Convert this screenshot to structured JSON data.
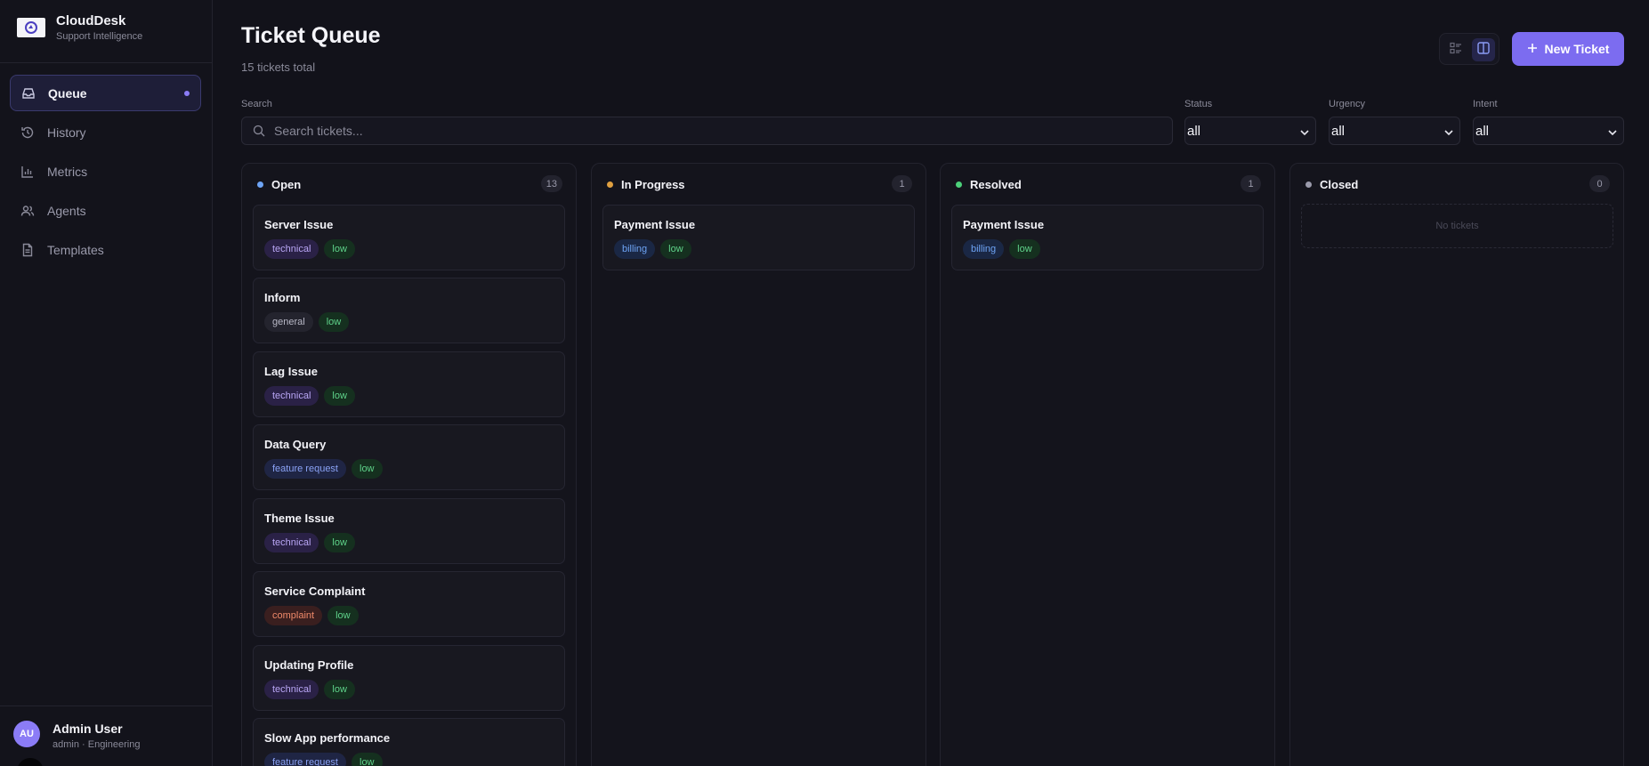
{
  "brand": {
    "name": "CloudDesk",
    "subtitle": "Support Intelligence"
  },
  "nav": [
    {
      "label": "Queue",
      "icon": "inbox-icon",
      "active": true
    },
    {
      "label": "History",
      "icon": "history-icon"
    },
    {
      "label": "Metrics",
      "icon": "bar-chart-icon"
    },
    {
      "label": "Agents",
      "icon": "users-icon"
    },
    {
      "label": "Templates",
      "icon": "file-text-icon"
    }
  ],
  "user": {
    "initials": "AU",
    "name": "Admin User",
    "role": "admin · Engineering"
  },
  "header": {
    "title": "Ticket Queue",
    "subtitle": "15 tickets total",
    "new_ticket_label": "New Ticket"
  },
  "filters": {
    "search_label": "Search",
    "search_placeholder": "Search tickets...",
    "status_label": "Status",
    "status_value": "all",
    "urgency_label": "Urgency",
    "urgency_value": "all",
    "intent_label": "Intent",
    "intent_value": "all"
  },
  "colors": {
    "accent": "#7c6cf0",
    "open": "#6ea4f5",
    "in_progress": "#e0a040",
    "resolved": "#4cd07a",
    "closed": "#9a9aab"
  },
  "columns": [
    {
      "title": "Open",
      "count": "13",
      "cards": [
        {
          "title": "Server Issue",
          "intent": "technical",
          "urgency": "low"
        },
        {
          "title": "Inform",
          "intent": "general",
          "urgency": "low"
        },
        {
          "title": "Lag Issue",
          "intent": "technical",
          "urgency": "low"
        },
        {
          "title": "Data Query",
          "intent": "feature request",
          "urgency": "low"
        },
        {
          "title": "Theme Issue",
          "intent": "technical",
          "urgency": "low"
        },
        {
          "title": "Service Complaint",
          "intent": "complaint",
          "urgency": "low"
        },
        {
          "title": "Updating Profile",
          "intent": "technical",
          "urgency": "low"
        },
        {
          "title": "Slow App performance",
          "intent": "feature request",
          "urgency": "low"
        }
      ]
    },
    {
      "title": "In Progress",
      "count": "1",
      "cards": [
        {
          "title": "Payment Issue",
          "intent": "billing",
          "urgency": "low"
        }
      ]
    },
    {
      "title": "Resolved",
      "count": "1",
      "cards": [
        {
          "title": "Payment Issue",
          "intent": "billing",
          "urgency": "low"
        }
      ]
    },
    {
      "title": "Closed",
      "count": "0",
      "empty_text": "No tickets",
      "cards": []
    }
  ]
}
